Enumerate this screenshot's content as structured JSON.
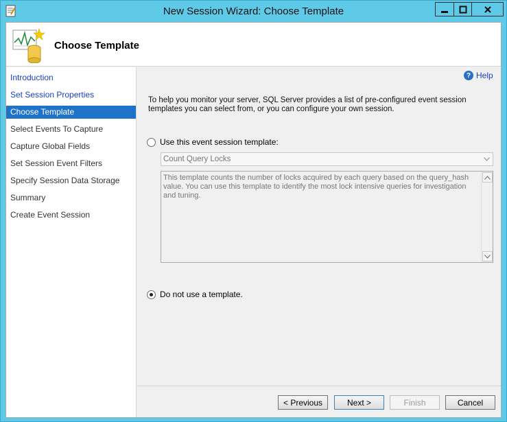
{
  "window": {
    "title": "New Session Wizard: Choose Template"
  },
  "header": {
    "page_title": "Choose Template"
  },
  "sidebar": {
    "items": [
      {
        "label": "Introduction",
        "state": "link"
      },
      {
        "label": "Set Session Properties",
        "state": "link"
      },
      {
        "label": "Choose Template",
        "state": "active"
      },
      {
        "label": "Select Events To Capture",
        "state": "plain"
      },
      {
        "label": "Capture Global Fields",
        "state": "plain"
      },
      {
        "label": "Set Session Event Filters",
        "state": "plain"
      },
      {
        "label": "Specify Session Data Storage",
        "state": "plain"
      },
      {
        "label": "Summary",
        "state": "plain"
      },
      {
        "label": "Create Event Session",
        "state": "plain"
      }
    ]
  },
  "main": {
    "help_label": "Help",
    "intro": "To help you monitor your server, SQL Server provides a list of pre-configured event session templates you can select from, or you can configure your own session.",
    "option_use_template": "Use this event session template:",
    "option_use_template_selected": false,
    "template_selected": "Count Query Locks",
    "template_description": "This template counts the number of locks acquired by each query based on the query_hash value. You can use this template to identify the most lock intensive queries for investigation and tuning.",
    "option_no_template": "Do not use a template.",
    "option_no_template_selected": true
  },
  "footer": {
    "previous_label": "< Previous",
    "next_label": "Next >",
    "finish_label": "Finish",
    "cancel_label": "Cancel"
  },
  "colors": {
    "titlebar": "#5fc9e8",
    "active_nav": "#1e73c8",
    "link": "#1a3fbf"
  }
}
